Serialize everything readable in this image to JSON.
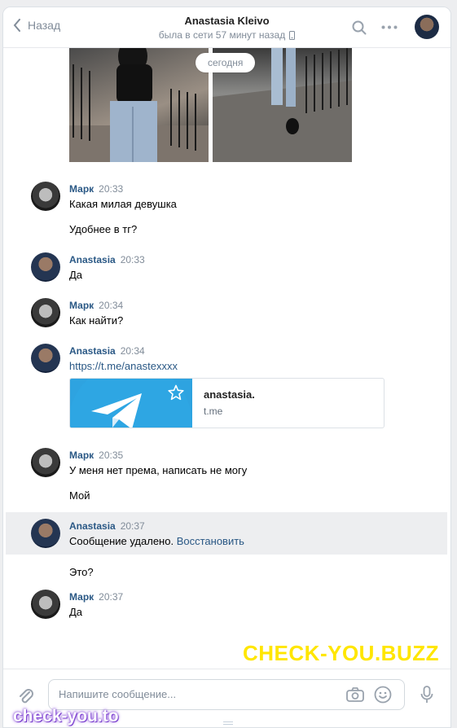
{
  "header": {
    "back_label": "Назад",
    "title": "Anastasia Kleivo",
    "status": "была в сети 57 минут назад"
  },
  "chat": {
    "date_badge": "сегодня",
    "messages": [
      {
        "author": "Марк",
        "time": "20:33",
        "lines": [
          "Какая милая девушка",
          "Удобнее в тг?"
        ]
      },
      {
        "author": "Anastasia",
        "time": "20:33",
        "lines": [
          "Да"
        ]
      },
      {
        "author": "Марк",
        "time": "20:34",
        "lines": [
          "Как найти?"
        ]
      },
      {
        "author": "Anastasia",
        "time": "20:34",
        "lines": [
          "https://t.me/anastexxxx"
        ],
        "card": {
          "title": "anastasia.",
          "domain": "t.me"
        }
      },
      {
        "author": "Марк",
        "time": "20:35",
        "lines": [
          "У меня нет према, написать не могу",
          "Мой"
        ]
      },
      {
        "author": "Anastasia",
        "time": "20:37",
        "deleted_text": "Сообщение удалено.",
        "restore_label": "Восстановить",
        "lines": [
          "Это?"
        ]
      },
      {
        "author": "Марк",
        "time": "20:37",
        "lines": [
          "Да"
        ]
      }
    ]
  },
  "composer": {
    "placeholder": "Напишите сообщение..."
  },
  "watermarks": {
    "main": "CHECK-YOU.BUZZ",
    "corner": "check-you.to"
  },
  "colors": {
    "link": "#2a5885",
    "watermark": "#ffe600",
    "telegram": "#2ea6e3"
  }
}
